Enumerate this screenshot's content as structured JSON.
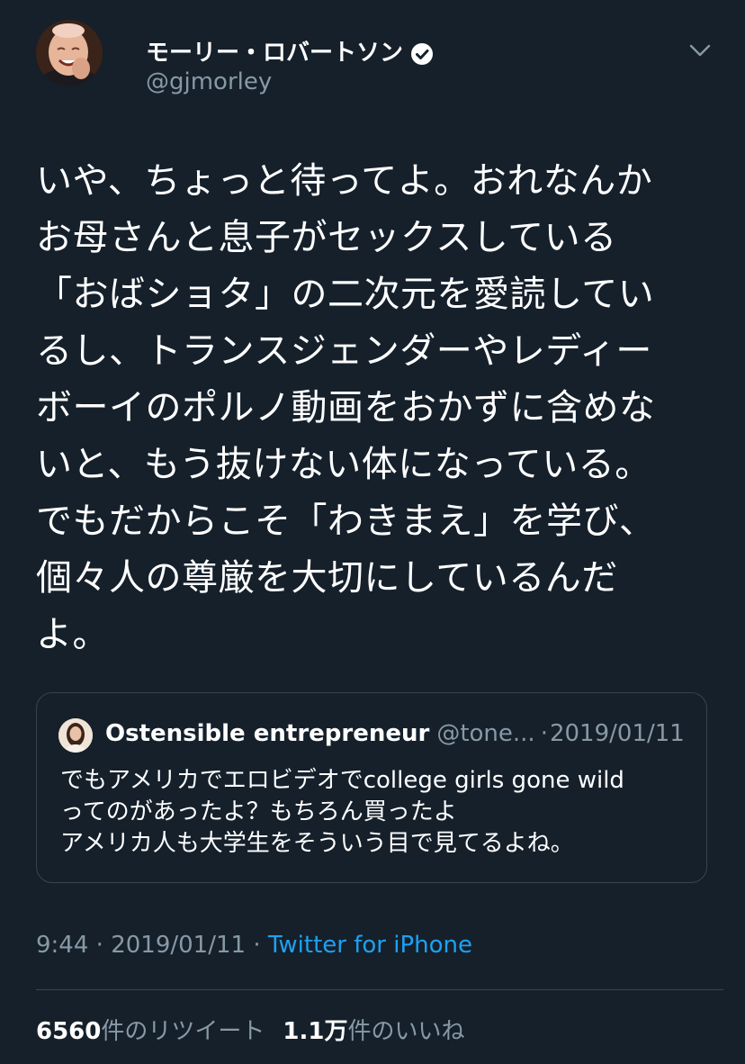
{
  "author": {
    "name": "モーリー・ロバートソン",
    "handle": "@gjmorley",
    "verified": true
  },
  "tweet": {
    "text": "いや、ちょっと待ってよ。おれなんか\nお母さんと息子がセックスしている\n「おばショタ」の二次元を愛読してい\nるし、トランスジェンダーやレディー\nボーイのポルノ動画をおかずに含めな\nいと、もう抜けない体になっている。\nでもだからこそ「わきまえ」を学び、\n個々人の尊厳を大切にしているんだ\nよ。"
  },
  "quote": {
    "name": "Ostensible entrepreneur",
    "handle": "@tone...",
    "dot": "·",
    "date": "2019/01/11",
    "text": "でもアメリカでエロビデオでcollege girls gone wild\nってのがあったよ？もちろん買ったよ\nアメリカ人も大学生をそういう目で見てるよね。"
  },
  "meta": {
    "time": "9:44",
    "sep1": "·",
    "date": "2019/01/11",
    "sep2": "·",
    "source": "Twitter for iPhone"
  },
  "stats": {
    "retweets_count": "6560",
    "retweets_label": "件のリツイート",
    "likes_count": "1.1万",
    "likes_label": "件のいいね"
  },
  "colors": {
    "background": "#15202b",
    "text_primary": "#ffffff",
    "text_secondary": "#8899a6",
    "link": "#1da1f2",
    "border": "#38444d"
  },
  "icons": {
    "verified": "verified-badge-icon",
    "menu": "chevron-down-icon"
  }
}
